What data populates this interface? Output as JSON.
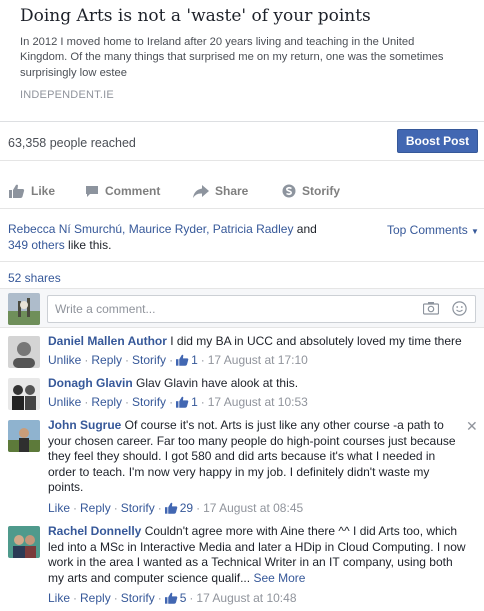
{
  "link_card": {
    "title": "Doing Arts is not a 'waste' of your points",
    "description": "In 2012 I moved home to Ireland after 20 years living and teaching in the United Kingdom. Of the many things that surprised me on my return, one was the sometimes surprisingly low estee",
    "source": "INDEPENDENT.IE"
  },
  "reach": {
    "text": "63,358 people reached",
    "boost_label": "Boost Post"
  },
  "actions": {
    "like": "Like",
    "comment": "Comment",
    "share": "Share",
    "storify": "Storify"
  },
  "likes": {
    "names": "Rebecca Ní Smurchú, Maurice Ryder, Patricia Radley",
    "and": " and ",
    "others": "349 others",
    "suffix": " like this."
  },
  "top_comments_label": "Top Comments",
  "shares_text": "52 shares",
  "comment_input": {
    "placeholder": "Write a comment..."
  },
  "comments": [
    {
      "author": "Daniel Mallen Author",
      "text": " I did my BA in UCC and absolutely loved my time there",
      "unlike": "Unlike",
      "reply": "Reply",
      "storify": "Storify",
      "likes": "1",
      "time": "17 August at 17:10"
    },
    {
      "author": "Donagh Glavin",
      "mention": " Glav Glavin",
      "text": " have alook at this.",
      "unlike": "Unlike",
      "reply": "Reply",
      "storify": "Storify",
      "likes": "1",
      "time": "17 August at 10:53"
    },
    {
      "author": "John Sugrue",
      "text": " Of course it's not. Arts is just like any other course -a path to your chosen career. Far too many people do high-point courses just because they feel they should. I got 580 and did arts because it's what I needed in order to teach. I'm now very happy in my job. I definitely didn't waste my points.",
      "unlike": "Like",
      "reply": "Reply",
      "storify": "Storify",
      "likes": "29",
      "time": "17 August at 08:45"
    },
    {
      "author": "Rachel Donnelly",
      "text": " Couldn't agree more with Aine there ^^ I did Arts too, which led into a MSc in Interactive Media and later a HDip in Cloud Computing. I now work in the area I wanted as a Technical Writer in an IT company, using both my arts and computer science qualif...",
      "see_more": "See More",
      "unlike": "Like",
      "reply": "Reply",
      "storify": "Storify",
      "likes": "5",
      "time": "17 August at 10:48"
    }
  ],
  "colors": {
    "link_blue": "#365899",
    "boost_blue": "#4267b2",
    "meta_grey": "#90949c",
    "like_thumb": "#4267b2"
  },
  "icons": [
    "like-icon",
    "comment-icon",
    "share-icon",
    "storify-icon",
    "camera-icon",
    "emoji-icon",
    "thumbs-up-icon",
    "close-icon",
    "dropdown-caret-icon"
  ]
}
